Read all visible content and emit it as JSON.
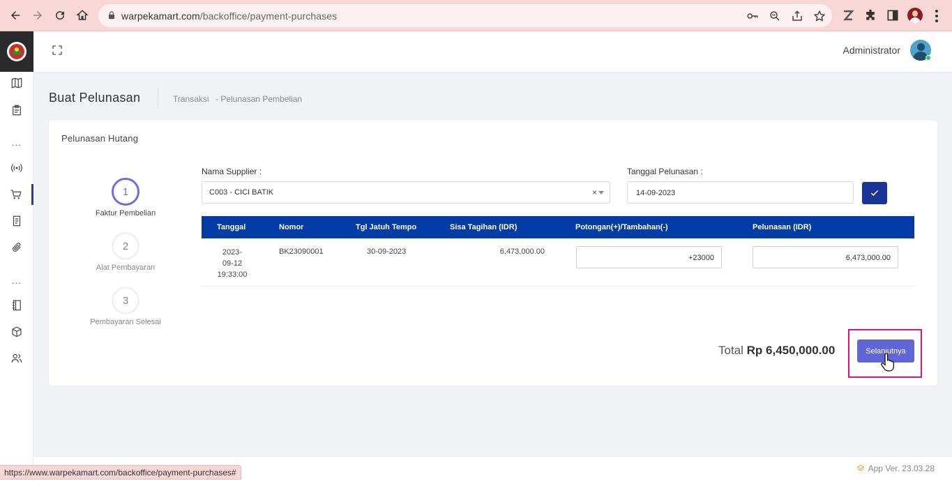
{
  "browser": {
    "url_domain": "warpekamart.com",
    "url_path": "/backoffice/payment-purchases",
    "status_url": "https://www.warpekamart.com/backoffice/payment-purchases#"
  },
  "topbar": {
    "user_name": "Administrator"
  },
  "header": {
    "title": "Buat Pelunasan",
    "breadcrumb": [
      "Transaksi",
      "-  Pelunasan Pembelian"
    ]
  },
  "card": {
    "title": "Pelunasan Hutang",
    "steps": [
      {
        "number": "1",
        "label": "Faktur Pembelian",
        "active": true
      },
      {
        "number": "2",
        "label": "Alat Pembayaran",
        "active": false
      },
      {
        "number": "3",
        "label": "Pembayaran Selesai",
        "active": false
      }
    ],
    "supplier_label": "Nama Supplier :",
    "supplier_value": "C003 - CICI BATIK",
    "clear_symbol": "×",
    "date_label": "Tanggal Pelunasan :",
    "date_value": "14-09-2023"
  },
  "table": {
    "headers": [
      "Tanggal",
      "Nomor",
      "Tgl Jatuh Tempo",
      "Sisa Tagihan (IDR)",
      "Potongan(+)/Tambahan(-)",
      "Pelunasan (IDR)"
    ],
    "rows": [
      {
        "tanggal": [
          "2023-",
          "09-12",
          "19:33:00"
        ],
        "nomor": "BK23090001",
        "jatuh_tempo": "30-09-2023",
        "sisa_tagihan": "6,473,000.00",
        "potongan": "+23000",
        "pelunasan": "6,473,000.00"
      }
    ]
  },
  "summary": {
    "total_label": "Total",
    "total_value": "Rp 6,450,000.00",
    "next_button": "Selanjutnya"
  },
  "footer": {
    "version": "App Ver. 23.03.28"
  },
  "colors": {
    "primary": "#013ca6",
    "accent": "#6166d6",
    "highlight": "#e0117f"
  }
}
